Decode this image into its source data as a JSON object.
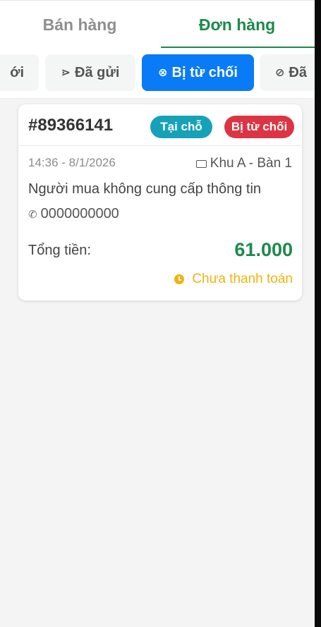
{
  "tabs": [
    {
      "label": "Bán hàng",
      "active": false
    },
    {
      "label": "Đơn hàng",
      "active": true
    }
  ],
  "filters": [
    {
      "label": "ới",
      "icon": "new-icon"
    },
    {
      "label": "Đã gửi",
      "icon": "send-icon",
      "glyph": "⋗"
    },
    {
      "label": "Bị từ chối",
      "icon": "x-circle-icon",
      "glyph": "⊗",
      "active": true
    },
    {
      "label": "Đã",
      "icon": "check-circle-icon",
      "glyph": "⊘"
    }
  ],
  "order": {
    "id": "#89366141",
    "type_badge": "Tại chỗ",
    "status_badge": "Bị từ chối",
    "time": "14:36 - 8/1/2026",
    "table": "Khu A - Bàn 1",
    "customer": "Người mua không cung cấp thông tin",
    "phone": "0000000000",
    "total_label": "Tổng tiền:",
    "total_value": "61.000",
    "payment_status": "Chưa thanh toán"
  },
  "colors": {
    "primary_green": "#1c8a4c",
    "active_chip_blue": "#0a7bf6",
    "badge_teal": "#15a2b8",
    "badge_red": "#db3545",
    "unpaid_yellow": "#f2b30d"
  }
}
